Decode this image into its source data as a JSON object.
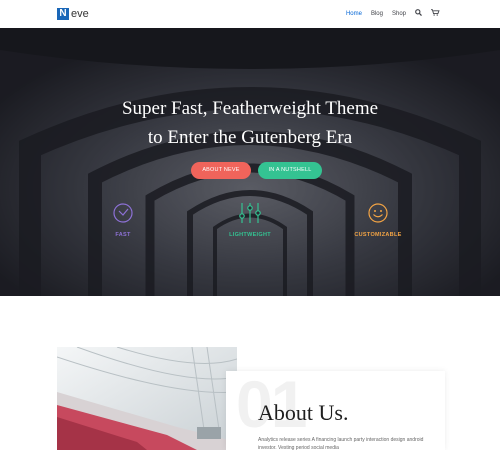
{
  "header": {
    "logo_letter": "N",
    "logo_text": "eve",
    "nav": [
      "Home",
      "Blog",
      "Shop"
    ],
    "search_icon": "search-icon",
    "cart_icon": "cart-icon",
    "active_color": "#0366d6"
  },
  "hero": {
    "title_line1": "Super Fast, Featherweight Theme",
    "title_line2": "to Enter the Gutenberg Era",
    "buttons": [
      {
        "label": "ABOUT NEVE",
        "color": "#f0645b"
      },
      {
        "label": "IN A NUTSHELL",
        "color": "#34c392"
      }
    ],
    "features": [
      {
        "label": "FAST",
        "icon": "clock-icon",
        "color": "#8d71d6"
      },
      {
        "label": "LIGHTWEIGHT",
        "icon": "sliders-icon",
        "color": "#34c392"
      },
      {
        "label": "CUSTOMIZABLE",
        "icon": "smiley-icon",
        "color": "#f3a444"
      }
    ]
  },
  "about": {
    "number": "01",
    "title": "About Us.",
    "text": "Analytics release series A financing launch party interaction design android investor. Vesting period social media"
  }
}
